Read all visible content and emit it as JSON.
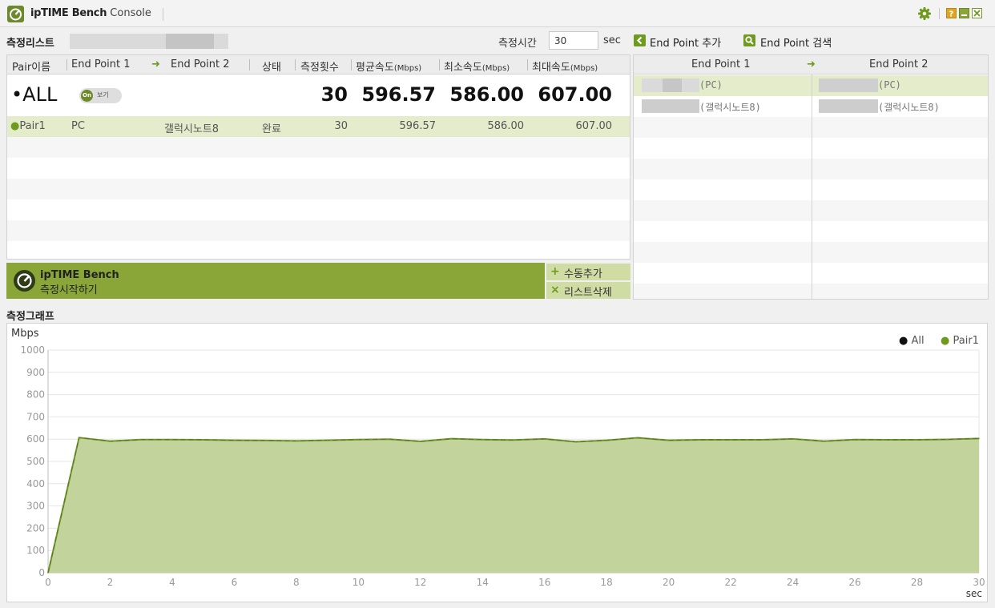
{
  "app": {
    "title_brand": "ipTIME Bench",
    "title_suffix": "Console",
    "icons": {
      "logo": "gauge-icon",
      "settings": "gear-icon",
      "help": "help-icon",
      "minimize": "minimize-icon",
      "close": "close-icon"
    }
  },
  "measure_list": {
    "title": "측정리스트",
    "time_label": "측정시간",
    "time_value": "30",
    "time_unit": "sec",
    "add_endpoint": "End Point 추가",
    "search_endpoint": "End Point 검색",
    "columns": {
      "pair_name": "Pair이름",
      "end_point_1": "End Point 1",
      "arrow": "➜",
      "end_point_2": "End Point 2",
      "status": "상태",
      "count": "측정횟수",
      "avg_speed": "평균속도",
      "min_speed": "최소속도",
      "max_speed": "최대속도",
      "unit": "(Mbps)"
    },
    "all_row": {
      "bullet": "•",
      "label": "ALL",
      "toggle_on": "On",
      "toggle_text": "보기",
      "count": "30",
      "avg": "596.57",
      "min": "586.00",
      "max": "607.00"
    },
    "pairs": [
      {
        "bullet": "●",
        "name": "Pair1",
        "end_point_1": "PC",
        "end_point_2": "갤럭시노트8",
        "status": "완료",
        "count": "30",
        "avg": "596.57",
        "min": "586.00",
        "max": "607.00"
      }
    ]
  },
  "start_bar": {
    "brand": "ipTIME Bench",
    "action": "측정시작하기",
    "manual_add": "수동추가",
    "manual_add_icon": "+",
    "list_delete": "리스트삭제",
    "list_delete_icon": "×"
  },
  "endpoints_panel": {
    "col1": "End Point 1",
    "arrow": "➜",
    "col2": "End Point 2",
    "rows": [
      {
        "ep1": "(PC)",
        "ep2": "(PC)"
      },
      {
        "ep1": "(갤럭시노트8)",
        "ep2": "(갤럭시노트8)"
      }
    ]
  },
  "graph": {
    "title": "측정그래프",
    "y_unit": "Mbps",
    "x_unit": "sec",
    "legend": [
      {
        "bullet": "●",
        "name": "All",
        "color": "#111111"
      },
      {
        "bullet": "●",
        "name": "Pair1",
        "color": "#6e9a1e"
      }
    ]
  },
  "chart_data": {
    "type": "area",
    "xlabel": "sec",
    "ylabel": "Mbps",
    "xlim": [
      0,
      30
    ],
    "ylim": [
      0,
      1000
    ],
    "x_ticks": [
      0,
      2,
      4,
      6,
      8,
      10,
      12,
      14,
      16,
      18,
      20,
      22,
      24,
      26,
      28,
      30
    ],
    "y_ticks": [
      0,
      100,
      200,
      300,
      400,
      500,
      600,
      700,
      800,
      900,
      1000
    ],
    "grid": true,
    "legend_position": "top-right",
    "series": [
      {
        "name": "Pair1",
        "color": "#6e9a1e",
        "x": [
          0,
          1,
          2,
          3,
          4,
          5,
          6,
          7,
          8,
          9,
          10,
          11,
          12,
          13,
          14,
          15,
          16,
          17,
          18,
          19,
          20,
          21,
          22,
          23,
          24,
          25,
          26,
          27,
          28,
          29,
          30
        ],
        "values": [
          0,
          607,
          591,
          598,
          598,
          597,
          595,
          594,
          592,
          595,
          598,
          600,
          590,
          602,
          598,
          596,
          601,
          588,
          595,
          606,
          595,
          597,
          597,
          597,
          601,
          591,
          598,
          597,
          597,
          599,
          603
        ]
      },
      {
        "name": "All",
        "color": "#111111",
        "x": [
          0,
          1,
          2,
          3,
          4,
          5,
          6,
          7,
          8,
          9,
          10,
          11,
          12,
          13,
          14,
          15,
          16,
          17,
          18,
          19,
          20,
          21,
          22,
          23,
          24,
          25,
          26,
          27,
          28,
          29,
          30
        ],
        "values": [
          0,
          607,
          591,
          598,
          598,
          597,
          595,
          594,
          592,
          595,
          598,
          600,
          590,
          602,
          598,
          596,
          601,
          588,
          595,
          606,
          595,
          597,
          597,
          597,
          601,
          591,
          598,
          597,
          597,
          599,
          603
        ]
      }
    ]
  }
}
